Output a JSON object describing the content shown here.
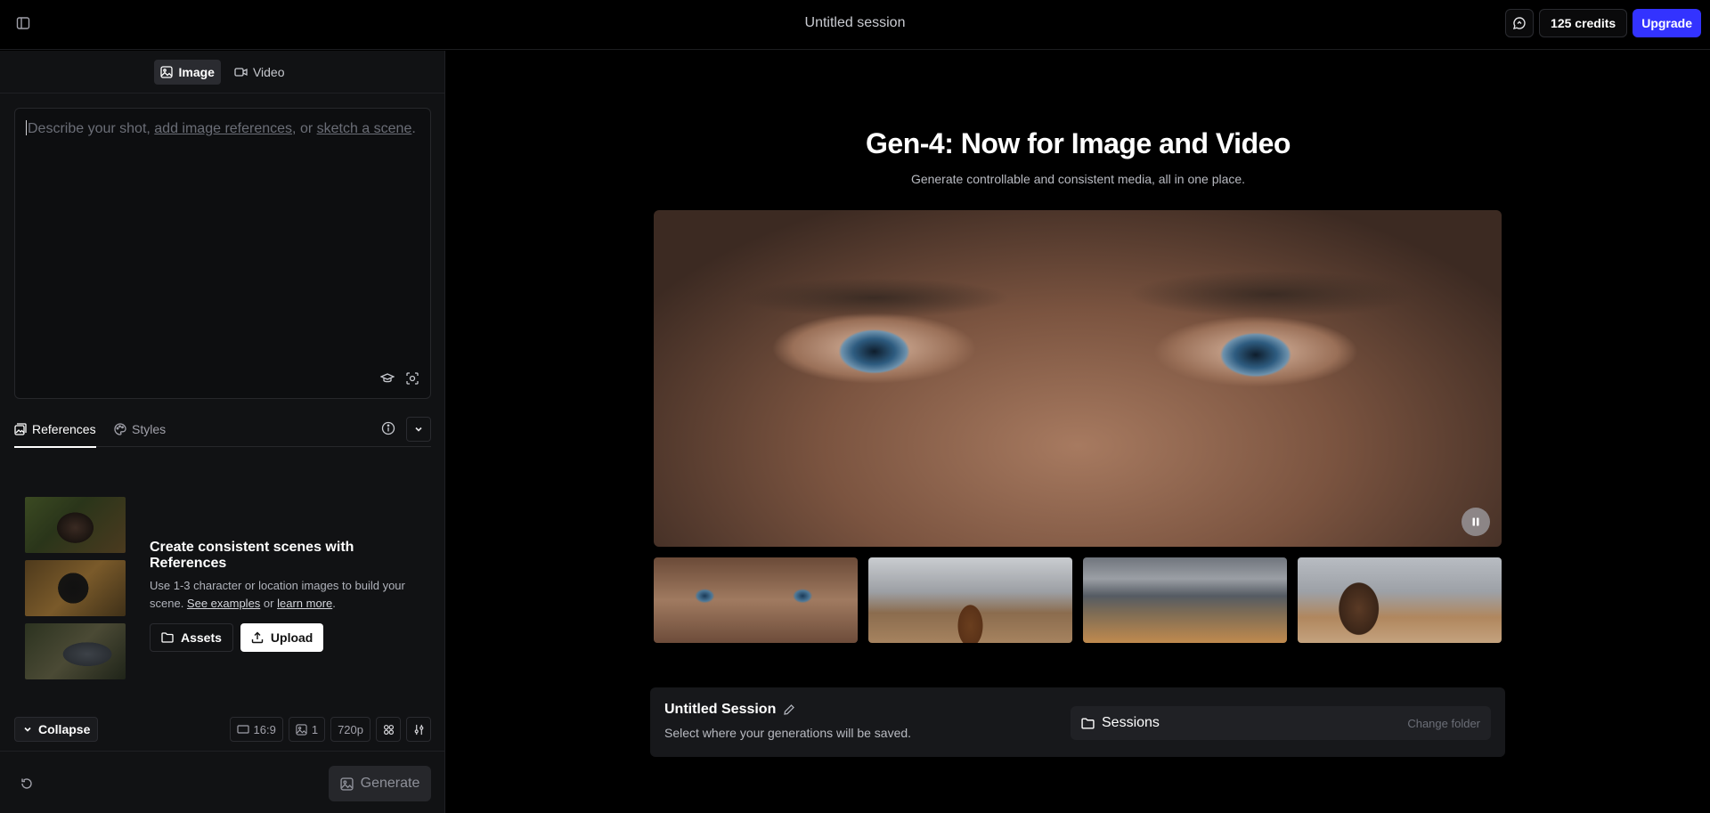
{
  "header": {
    "session_title": "Untitled session",
    "credits_label": "125 credits",
    "upgrade_label": "Upgrade"
  },
  "sidebar": {
    "mode_tabs": [
      {
        "label": "Image",
        "icon": "image-icon",
        "active": true
      },
      {
        "label": "Video",
        "icon": "video-icon",
        "active": false
      }
    ],
    "prompt": {
      "placeholder_start": "Describe your shot, ",
      "placeholder_link1": "add image references",
      "placeholder_mid": ", or ",
      "placeholder_link2": "sketch a scene",
      "placeholder_end": ".",
      "value": ""
    },
    "ref_tabs": [
      {
        "label": "References",
        "icon": "references-icon",
        "active": true
      },
      {
        "label": "Styles",
        "icon": "palette-icon",
        "active": false
      }
    ],
    "references_cta": {
      "title": "Create consistent scenes with References",
      "desc_start": "Use 1-3 character or location images to build your scene. ",
      "link1": "See examples",
      "desc_mid": " or ",
      "link2": "learn more",
      "desc_end": ".",
      "assets_label": "Assets",
      "upload_label": "Upload"
    },
    "options": {
      "collapse_label": "Collapse",
      "aspect_ratio": "16:9",
      "image_count": "1",
      "resolution": "720p"
    },
    "generate_label": "Generate"
  },
  "main": {
    "hero_title": "Gen-4: Now for Image and Video",
    "hero_subtitle": "Generate controllable and consistent media, all in one place.",
    "session": {
      "name": "Untitled Session",
      "description": "Select where your generations will be saved.",
      "folder_label": "Sessions",
      "change_folder_label": "Change folder"
    }
  },
  "colors": {
    "accent": "#3333ff",
    "background": "#000000",
    "sidebar": "#111214"
  }
}
